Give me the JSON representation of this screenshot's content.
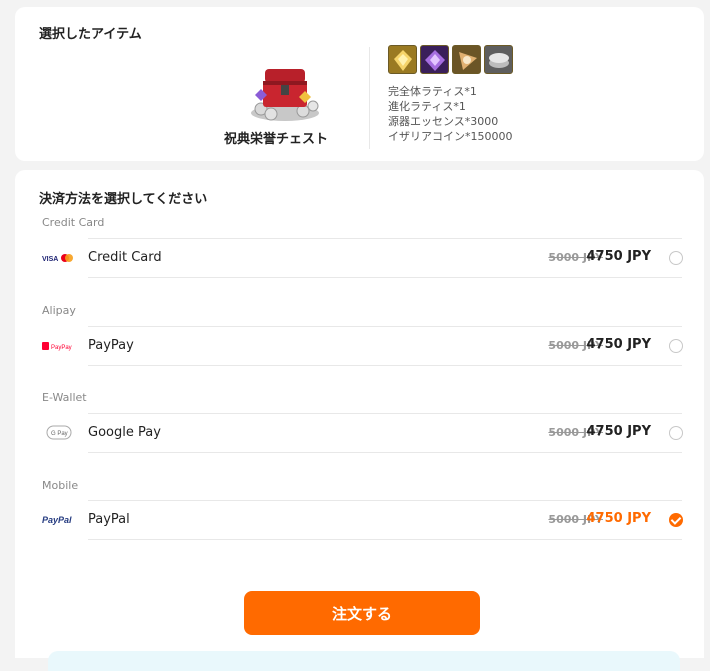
{
  "selected_item": {
    "title": "選択したアイテム",
    "name": "祝典栄誉チェスト",
    "reward_icons": [
      "gold-lattice-icon",
      "purple-crystal-icon",
      "essence-icon",
      "coin-icon"
    ],
    "contents": [
      "完全体ラティス*1",
      "進化ラティス*1",
      "源器エッセンス*3000",
      "イザリアコイン*150000"
    ]
  },
  "payment": {
    "title": "決済方法を選択してください",
    "groups": [
      {
        "label": "Credit Card",
        "method": "Credit Card",
        "logo": "visa-mastercard-logo",
        "old_price": "5000 JPY",
        "price": "4750 JPY",
        "selected": false
      },
      {
        "label": "Alipay",
        "method": "PayPay",
        "logo": "paypay-logo",
        "logo_text": "PayPay",
        "old_price": "5000 JPY",
        "price": "4750 JPY",
        "selected": false
      },
      {
        "label": "E-Wallet",
        "method": "Google Pay",
        "logo": "google-pay-logo",
        "logo_text": "G Pay",
        "old_price": "5000 JPY",
        "price": "4750 JPY",
        "selected": false
      },
      {
        "label": "Mobile",
        "method": "PayPal",
        "logo": "paypal-logo",
        "logo_text": "PayPal",
        "old_price": "5000 JPY",
        "price": "4750 JPY",
        "selected": true
      }
    ]
  },
  "order_button": "注文する",
  "colors": {
    "accent": "#ff6a00",
    "background": "#f3f3f3"
  }
}
